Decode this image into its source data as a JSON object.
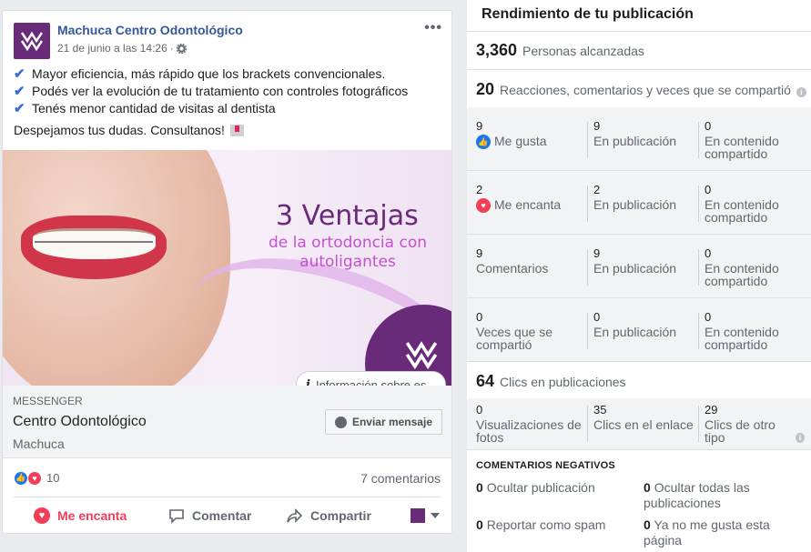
{
  "post": {
    "page_name": "Machuca Centro Odontológico",
    "date": "21 de junio a las 14:26",
    "date_separator": "·",
    "settings_icon": "gear-icon",
    "more_label": "•••",
    "lines": [
      "Mayor eficiencia, más rápido que los brackets convencionales.",
      "Podés ver la evolución de tu tratamiento con controles fotográficos",
      "Tenés menor cantidad de visitas al dentista"
    ],
    "closing": "Despejamos tus dudas. Consultanos!",
    "image": {
      "title": "3 Ventajas",
      "subtitle": "de la ortodoncia con autoligantes",
      "info_label": "Información sobre es"
    },
    "cta": {
      "kicker": "MESSENGER",
      "title": "Centro Odontológico",
      "subtitle": "Machuca",
      "button": "Enviar mensaje"
    },
    "reactions_count": "10",
    "comments_count": "7 comentarios",
    "actions": {
      "love": "Me encanta",
      "comment": "Comentar",
      "share": "Compartir"
    }
  },
  "insights": {
    "title": "Rendimiento de tu publicación",
    "reach": {
      "value": "3,360",
      "label": "Personas alcanzadas"
    },
    "engagement": {
      "value": "20",
      "label": "Reacciones, comentarios y veces que se compartió"
    },
    "rows": [
      {
        "total": "9",
        "label": "Me gusta",
        "icon": "like",
        "on_post": "9",
        "on_post_label": "En publicación",
        "shared": "0",
        "shared_label": "En contenido compartido"
      },
      {
        "total": "2",
        "label": "Me encanta",
        "icon": "love",
        "on_post": "2",
        "on_post_label": "En publicación",
        "shared": "0",
        "shared_label": "En contenido compartido"
      },
      {
        "total": "9",
        "label": "Comentarios",
        "icon": "",
        "on_post": "9",
        "on_post_label": "En publicación",
        "shared": "0",
        "shared_label": "En contenido compartido"
      },
      {
        "total": "0",
        "label": "Veces que se compartió",
        "icon": "",
        "on_post": "0",
        "on_post_label": "En publicación",
        "shared": "0",
        "shared_label": "En contenido compartido"
      }
    ],
    "clicks": {
      "value": "64",
      "label": "Clics en publicaciones"
    },
    "click_breakdown": [
      {
        "value": "0",
        "label": "Visualizaciones de fotos"
      },
      {
        "value": "35",
        "label": "Clics en el enlace"
      },
      {
        "value": "29",
        "label": "Clics de otro tipo"
      }
    ],
    "negative": {
      "header": "COMENTARIOS NEGATIVOS",
      "items": [
        {
          "value": "0",
          "label": "Ocultar publicación"
        },
        {
          "value": "0",
          "label": "Ocultar todas las publicaciones"
        },
        {
          "value": "0",
          "label": "Reportar como spam"
        },
        {
          "value": "0",
          "label": "Ya no me gusta esta página"
        }
      ]
    }
  }
}
